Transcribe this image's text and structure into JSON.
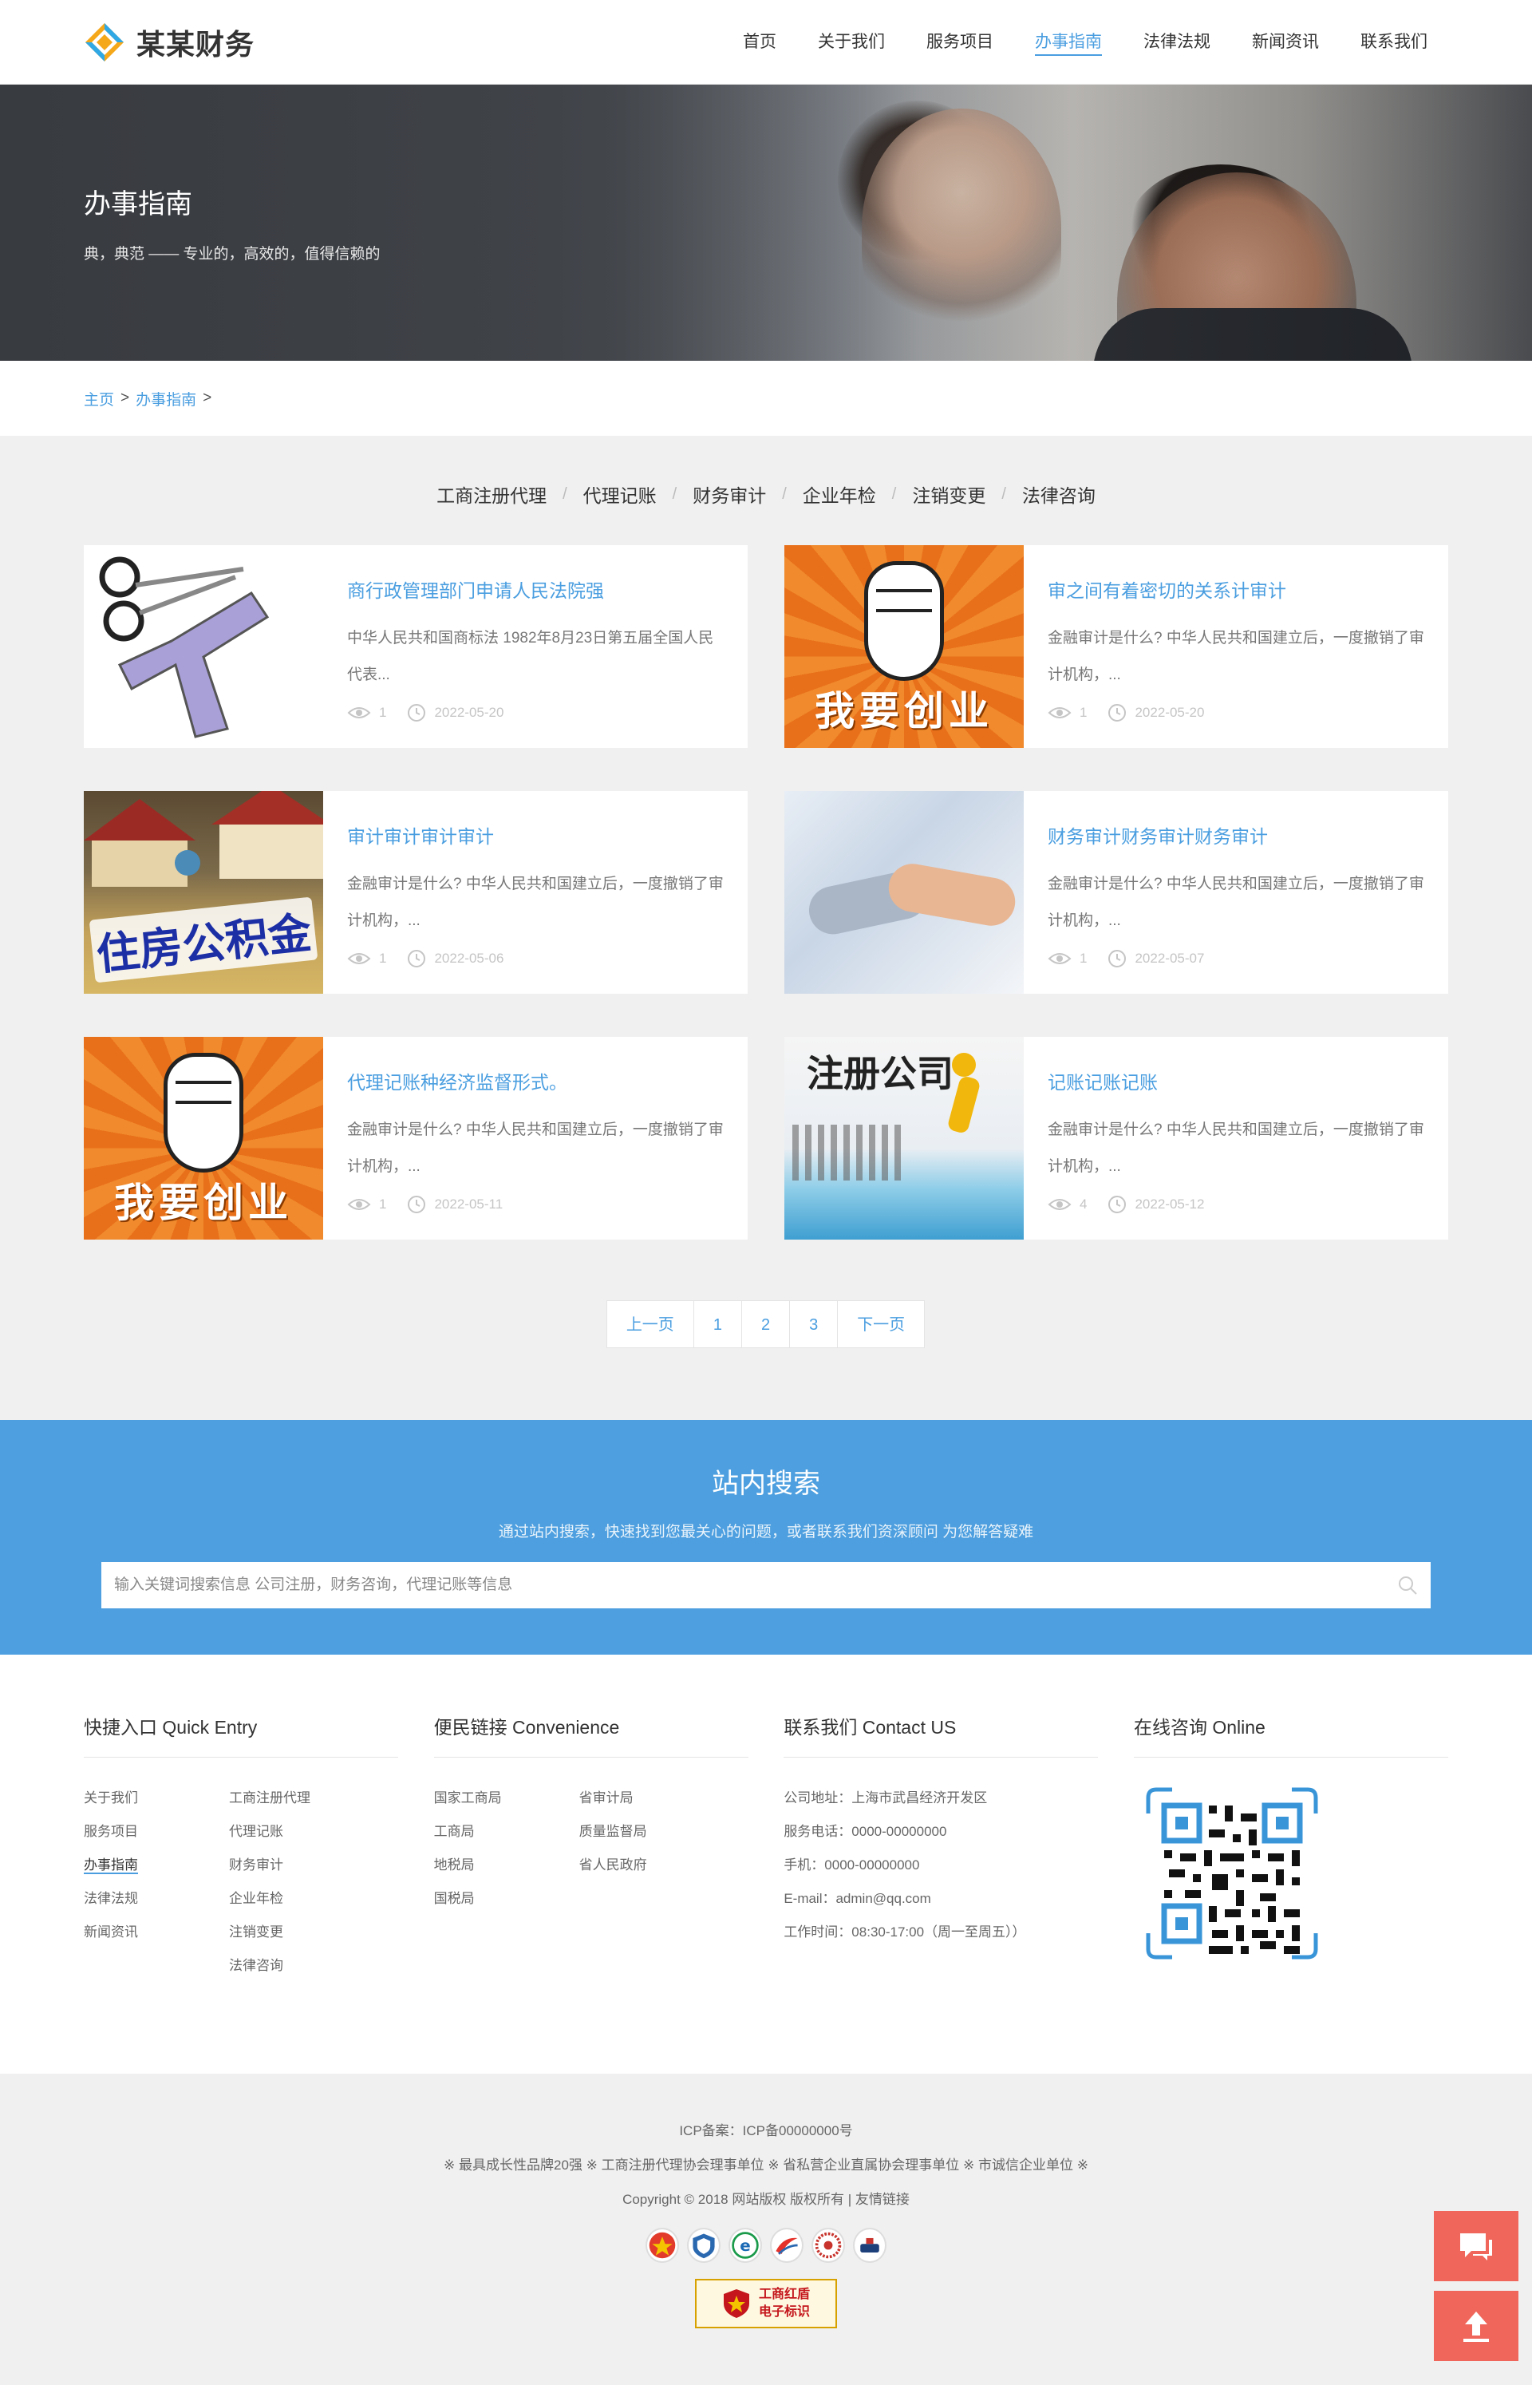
{
  "brand": {
    "name": "某某财务"
  },
  "nav": [
    "首页",
    "关于我们",
    "服务项目",
    "办事指南",
    "法律法规",
    "新闻资讯",
    "联系我们"
  ],
  "nav_active_index": 3,
  "banner": {
    "title": "办事指南",
    "subtitle": "典，典范 —— 专业的，高效的，值得信赖的"
  },
  "breadcrumb": {
    "home": "主页",
    "sep1": ">",
    "current": "办事指南",
    "sep2": ">"
  },
  "tabs": [
    "工商注册代理",
    "代理记账",
    "财务审计",
    "企业年检",
    "注销变更",
    "法律咨询"
  ],
  "tab_separator": "/",
  "articles": [
    {
      "title": "商行政管理部门申请人民法院强",
      "desc": "中华人民共和国商标法 1982年8月23日第五届全国人民代表...",
      "views": "1",
      "date": "2022-05-20",
      "thumb_text": ""
    },
    {
      "title": "审之间有着密切的关系计审计",
      "desc": "金融审计是什么? 中华人民共和国建立后，一度撤销了审计机构，...",
      "views": "1",
      "date": "2022-05-20",
      "thumb_text": "我要创业"
    },
    {
      "title": "审计审计审计审计",
      "desc": "金融审计是什么? 中华人民共和国建立后，一度撤销了审计机构，...",
      "views": "1",
      "date": "2022-05-06",
      "thumb_text": "住房公积金"
    },
    {
      "title": "财务审计财务审计财务审计",
      "desc": "金融审计是什么? 中华人民共和国建立后，一度撤销了审计机构，...",
      "views": "1",
      "date": "2022-05-07",
      "thumb_text": ""
    },
    {
      "title": "代理记账种经济监督形式。",
      "desc": "金融审计是什么? 中华人民共和国建立后，一度撤销了审计机构，...",
      "views": "1",
      "date": "2022-05-11",
      "thumb_text": "我要创业"
    },
    {
      "title": "记账记账记账",
      "desc": "金融审计是什么? 中华人民共和国建立后，一度撤销了审计机构，...",
      "views": "4",
      "date": "2022-05-12",
      "thumb_text": "注册公司"
    }
  ],
  "pager": {
    "prev": "上一页",
    "pages": [
      "1",
      "2",
      "3"
    ],
    "next": "下一页"
  },
  "search": {
    "title": "站内搜索",
    "subtitle": "通过站内搜索，快速找到您最关心的问题，或者联系我们资深顾问 为您解答疑难",
    "placeholder": "输入关键词搜索信息 公司注册，财务咨询，代理记账等信息"
  },
  "footer": {
    "quick": {
      "title": "快捷入口 Quick Entry",
      "col1": [
        "关于我们",
        "服务项目",
        "办事指南",
        "法律法规",
        "新闻资讯"
      ],
      "col2": [
        "工商注册代理",
        "代理记账",
        "财务审计",
        "企业年检",
        "注销变更",
        "法律咨询"
      ]
    },
    "links": {
      "title": "便民链接 Convenience",
      "col1": [
        "国家工商局",
        "工商局",
        "地税局",
        "国税局"
      ],
      "col2": [
        "省审计局",
        "质量监督局",
        "省人民政府"
      ]
    },
    "contact": {
      "title": "联系我们 Contact US",
      "lines": [
        "公司地址：上海市武昌经济开发区",
        "服务电话：0000-00000000",
        "手机：0000-00000000",
        "E-mail：admin@qq.com",
        "工作时间：08:30-17:00（周一至周五））"
      ]
    },
    "online": {
      "title": "在线咨询 Online"
    }
  },
  "bottom": {
    "icp": "ICP备案：ICP备00000000号",
    "honors": "※ 最具成长性品牌20强 ※ 工商注册代理协会理事单位 ※ 省私营企业直属协会理事单位 ※ 市诚信企业单位 ※",
    "copyright": "Copyright © 2018 网站版权 版权所有 | 友情链接",
    "red_badge": "工商红盾\n电子标识"
  },
  "colors": {
    "accent": "#4a9ee0",
    "search_bg": "#4d9fdf",
    "float": "#f0665a"
  },
  "icons": [
    "logo-diamond-icon",
    "eye-icon",
    "clock-icon",
    "search-icon",
    "qr-code-icon",
    "chat-icon",
    "back-to-top-icon"
  ]
}
